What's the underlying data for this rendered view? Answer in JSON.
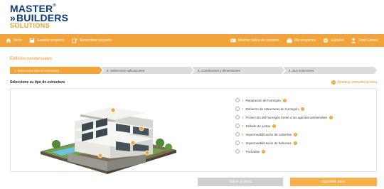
{
  "brand": {
    "line1": "MASTER",
    "reg": "®",
    "chevrons": "»",
    "line2": "BUILDERS",
    "line3": "SOLUTIONS"
  },
  "nav": {
    "left": [
      {
        "icon": "home-icon",
        "label": "Inicio"
      },
      {
        "icon": "save-icon",
        "label": "Guardar proyecto"
      },
      {
        "icon": "edit-icon",
        "label": "Renombrar proyecto"
      }
    ],
    "right": [
      {
        "icon": "id-card-icon",
        "label": "Mostrar datos de contacto"
      },
      {
        "icon": "briefcase-icon",
        "label": "Mis proyectos"
      },
      {
        "icon": "globe-icon",
        "label": "Español"
      },
      {
        "icon": "user-icon",
        "label": "Ariel Gómez"
      }
    ]
  },
  "page": {
    "section_title": "Edificios residenciales",
    "steps": [
      {
        "label": "1. Seleccione tipo de estructura",
        "active": true
      },
      {
        "label": "2. Seleccione aplicaciones",
        "active": false
      },
      {
        "label": "3. Condiciones y dimensiones",
        "active": false
      },
      {
        "label": "4. Sus soluciones",
        "active": false
      }
    ],
    "sub_label": "Seleccione su tipo de estructura",
    "consult_link": "Realizar consulta técnica"
  },
  "options": [
    {
      "num": "1",
      "label": "Reparación de hormigón"
    },
    {
      "num": "2",
      "label": "Refuerzo de estructuras de hormigón"
    },
    {
      "num": "3",
      "label": "Protección del hormigón frente a los agentes ambientales"
    },
    {
      "num": "4",
      "label": "Sellado de juntas"
    },
    {
      "num": "5",
      "label": "Impermeabilización de cubiertas"
    },
    {
      "num": "6",
      "label": "Impermeabilización de balcones"
    },
    {
      "num": "7",
      "label": "Fachadas"
    }
  ],
  "buttons": {
    "back": "Volver al inicio",
    "next": "Siguiente paso"
  },
  "colors": {
    "accent": "#f2a33a",
    "brand_blue": "#0b3a7e",
    "step_inactive": "#dcdcdc"
  }
}
